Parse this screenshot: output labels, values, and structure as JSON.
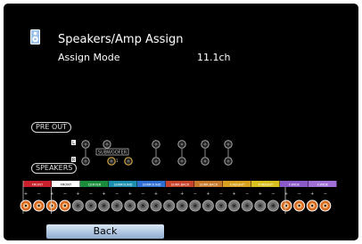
{
  "header": {
    "title": "Speakers/Amp Assign",
    "icon": "speaker-icon"
  },
  "assign_mode": {
    "label": "Assign Mode",
    "value": "11.1ch"
  },
  "pre_out": {
    "label": "PRE OUT",
    "left_label": "L",
    "right_label": "R",
    "subwoofer_label": "SUBWOOFER",
    "subwoofer_numbers": [
      "1",
      "2"
    ]
  },
  "speakers": {
    "label": "SPEAKERS",
    "groups": [
      {
        "label": "FRONT",
        "color": "#c8202c"
      },
      {
        "label": "FRONT",
        "color": "#ffffff"
      },
      {
        "label": "CENTER",
        "color": "#1a8c3c"
      },
      {
        "label": "SURROUND",
        "color": "#1c8fb0"
      },
      {
        "label": "SURROUND",
        "color": "#2f6fd2"
      },
      {
        "label": "SURR.BACK",
        "color": "#c8442c"
      },
      {
        "label": "SURR.BACK",
        "color": "#c87a2c"
      },
      {
        "label": "F.HEIGHT",
        "color": "#d8a020"
      },
      {
        "label": "F.HEIGHT",
        "color": "#d8c020"
      },
      {
        "label": "F.WIDE",
        "color": "#8a5ac8"
      },
      {
        "label": "F.WIDE",
        "color": "#a070d8"
      }
    ]
  },
  "footer": {
    "back_label": "Back"
  },
  "colors": {
    "background": "#000000",
    "text": "#ffffff",
    "active_terminal": "#d86a20",
    "inactive_terminal": "#888888",
    "back_button": "#a8c0de"
  }
}
